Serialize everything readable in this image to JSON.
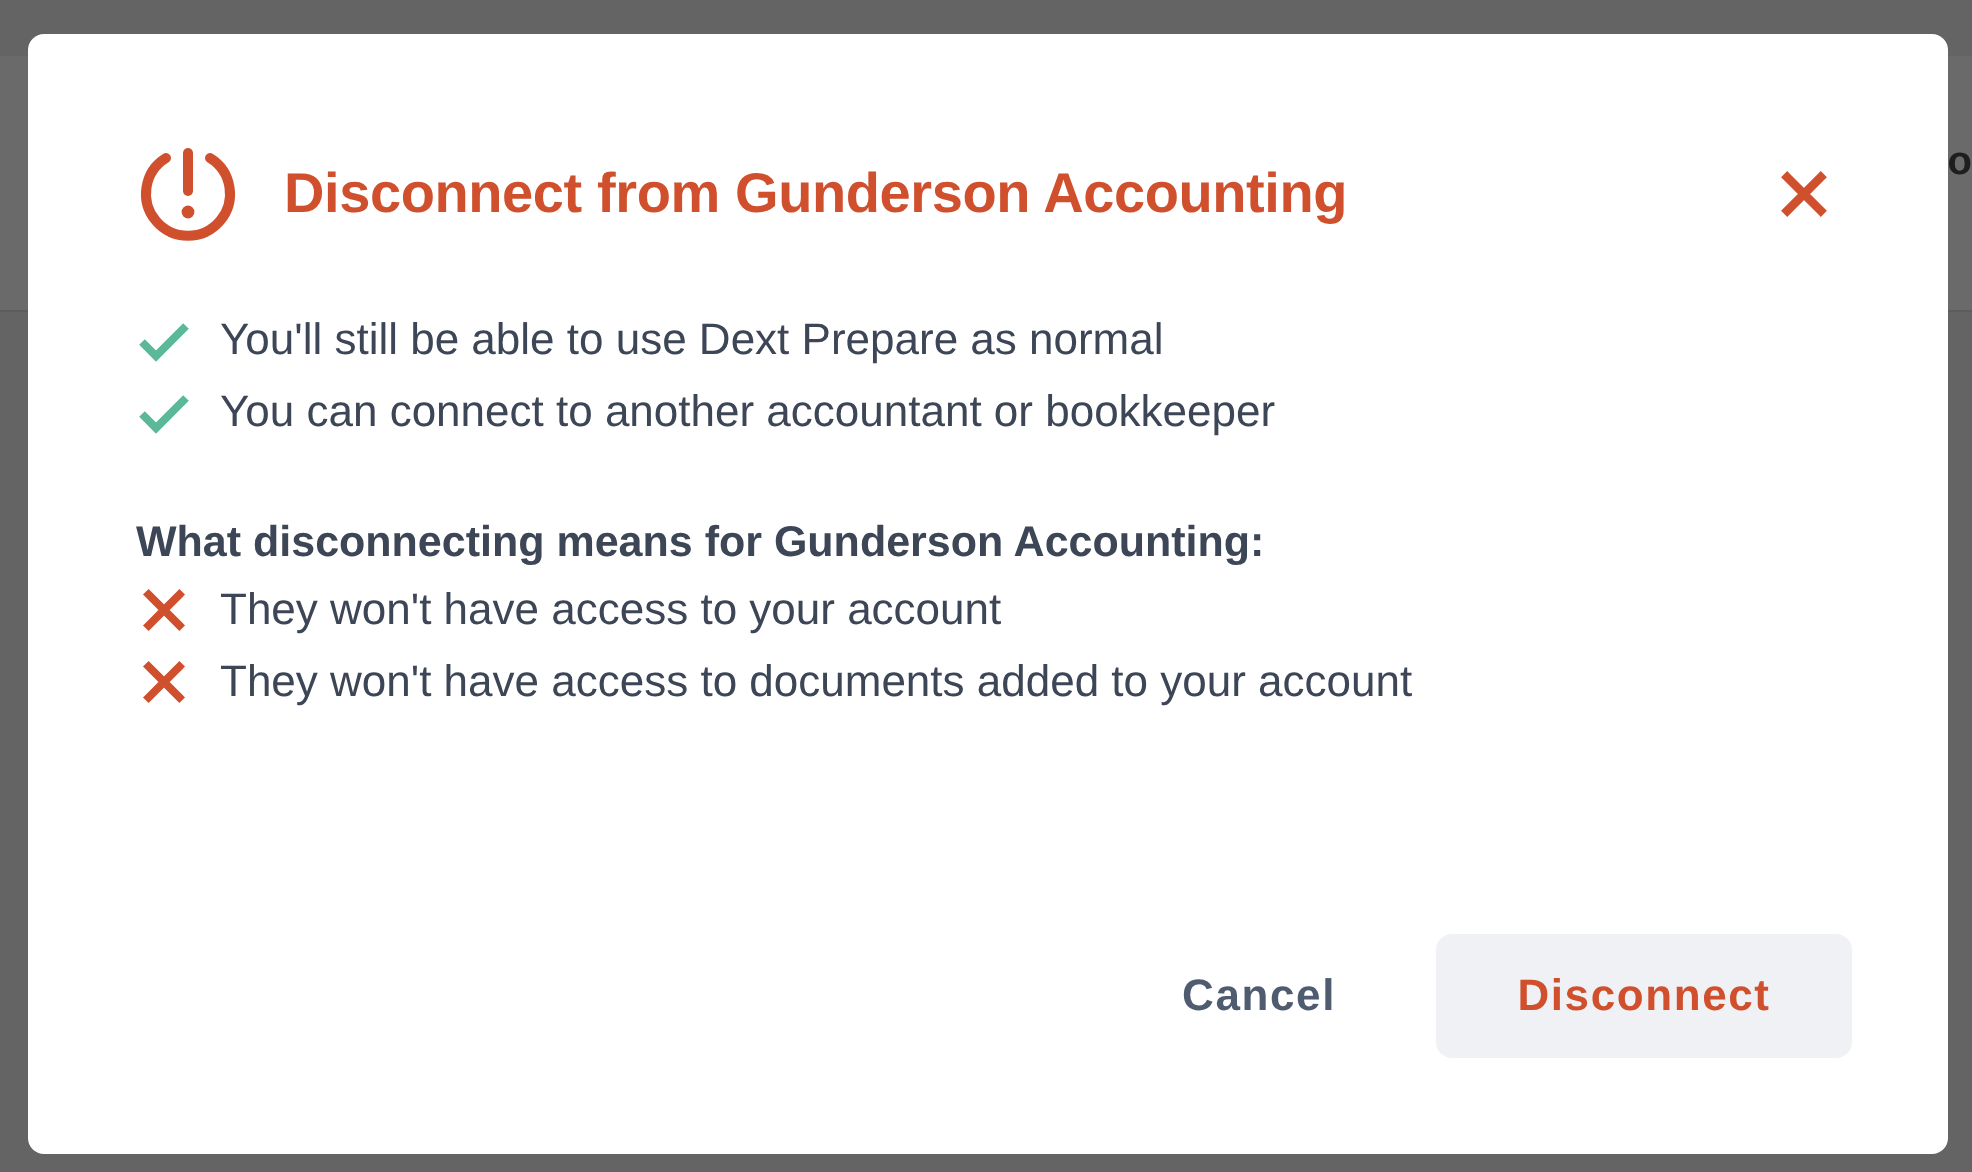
{
  "background": {
    "header_fragment": "o"
  },
  "dialog": {
    "title": "Disconnect from Gunderson Accounting",
    "benefits": [
      {
        "kind": "check",
        "text": "You'll still be able to use Dext Prepare as normal"
      },
      {
        "kind": "check",
        "text": "You can connect to another accountant or bookkeeper"
      }
    ],
    "consequences_heading": "What disconnecting means for Gunderson Accounting:",
    "consequences": [
      {
        "kind": "cross",
        "text": "They won't have access to your account"
      },
      {
        "kind": "cross",
        "text": "They won't have access to documents added to your account"
      }
    ],
    "buttons": [
      {
        "kind": "plain",
        "label": "Cancel"
      },
      {
        "kind": "danger",
        "label": "Disconnect"
      }
    ]
  }
}
